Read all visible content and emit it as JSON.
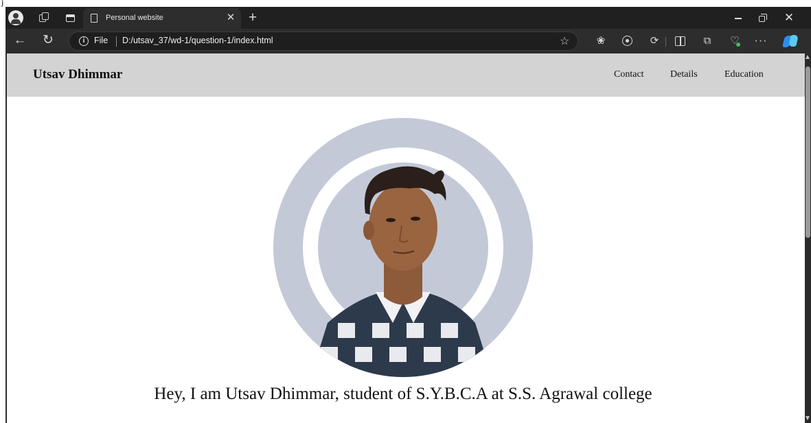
{
  "browser": {
    "tab": {
      "title": "Personal website"
    },
    "address": {
      "scheme_label": "File",
      "url": "D:/utsav_37/wd-1/question-1/index.html"
    },
    "icons": [
      "profile-icon",
      "workspaces-icon",
      "tab-actions-icon",
      "page-icon",
      "close-icon",
      "new-tab-icon",
      "minimize-icon",
      "restore-icon",
      "window-close-icon",
      "back-icon",
      "refresh-icon",
      "info-icon",
      "favorite-star-icon",
      "extension-icon",
      "target-icon",
      "puzzle-icon",
      "split-screen-icon",
      "collections-icon",
      "browser-essentials-icon",
      "more-icon",
      "copilot-icon"
    ]
  },
  "site": {
    "logo": "Utsav Dhimmar",
    "nav": {
      "contact": "Contact",
      "details": "Details",
      "education": "Education"
    },
    "hero": {
      "photo_alt": "Utsav Dhimmar",
      "intro": "Hey, I am Utsav Dhimmar, student of S.Y.B.C.A at S.S. Agrawal college"
    }
  },
  "colors": {
    "tabstrip_bg": "#202020",
    "toolbar_bg": "#2d2d2d",
    "site_nav_bg": "#d3d3d3",
    "photo_circle": "#c4c9d8",
    "page_bg": "#ffffff"
  }
}
